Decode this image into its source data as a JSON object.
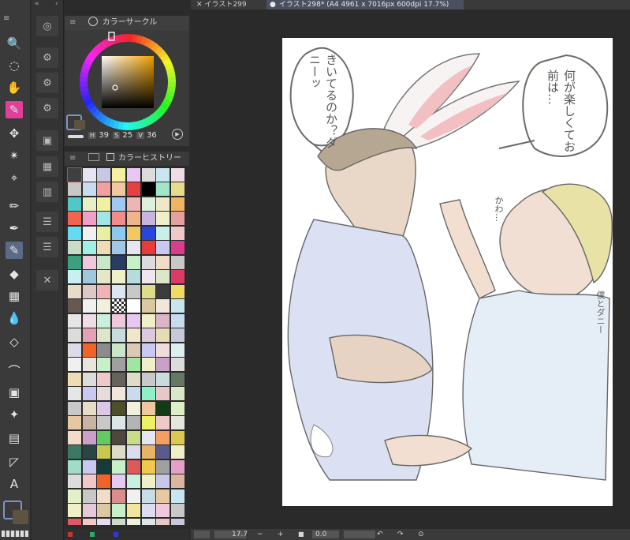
{
  "tabs": [
    {
      "label": "イラスト299",
      "active": false
    },
    {
      "label": "イラスト298* (A4 4961 x 7016px 600dpi 17.7%)",
      "active": true
    }
  ],
  "tools": [
    {
      "name": "zoom-icon",
      "glyph": "🔍"
    },
    {
      "name": "lasso-icon",
      "glyph": "◌"
    },
    {
      "name": "hand-icon",
      "glyph": "✋"
    },
    {
      "name": "pen-select-icon",
      "glyph": "✎"
    },
    {
      "name": "move-icon",
      "glyph": "✥"
    },
    {
      "name": "magic-wand-icon",
      "glyph": "✴"
    },
    {
      "name": "eyedropper-icon",
      "glyph": "⌖"
    },
    {
      "name": "pencil-icon",
      "glyph": "✏"
    },
    {
      "name": "ink-pen-icon",
      "glyph": "✒"
    },
    {
      "name": "brush-icon",
      "glyph": "✎"
    },
    {
      "name": "fill-icon",
      "glyph": "◆"
    },
    {
      "name": "airbrush-icon",
      "glyph": "▦"
    },
    {
      "name": "blend-icon",
      "glyph": "💧"
    },
    {
      "name": "eraser-icon",
      "glyph": "◇"
    },
    {
      "name": "vector-icon",
      "glyph": "⌒"
    },
    {
      "name": "gradient-icon",
      "glyph": "▣"
    },
    {
      "name": "sparkle-icon",
      "glyph": "✦"
    },
    {
      "name": "frame-icon",
      "glyph": "▤"
    },
    {
      "name": "ruler-icon",
      "glyph": "◸"
    },
    {
      "name": "text-icon",
      "glyph": "A"
    }
  ],
  "color_panel": {
    "title": "カラーサークル",
    "h_label": "H",
    "h_value": "39",
    "s_label": "S",
    "s_value": "25",
    "v_label": "V",
    "v_value": "36"
  },
  "history_panel": {
    "title": "カラーヒストリー"
  },
  "bottom_bar": {
    "zoom_value": "17.7",
    "rotate_value": "0.0"
  },
  "artwork": {
    "bubble_left_text": "きいてるのか？ダニーッ",
    "bubble_right_text": "何が楽しくてお前は…",
    "small_text": "かわ…",
    "signature": "僕とダニー"
  },
  "colors": {
    "accent_pink": "#e0409a",
    "panel_bg": "#3a3a3a",
    "canvas_bg": "#2a2a2a",
    "paper": "#ffffff"
  },
  "swatches": [
    "#404040",
    "#e6e6f0",
    "#c8c8e6",
    "#f5f0a0",
    "#e6c8f0",
    "#dcdcdc",
    "#c8e6f0",
    "#f0dce6",
    "#c8c8c8",
    "#c8dcf0",
    "#f0a0a0",
    "#f0c8a0",
    "#e64040",
    "#000000",
    "#a0e6c8",
    "#e6dc8c",
    "#50c8c8",
    "#e6f0c8",
    "#f0f0a0",
    "#a0c8f0",
    "#f0b4b4",
    "#dcf0dc",
    "#f0e6c8",
    "#f0b464",
    "#f06450",
    "#f0a0c8",
    "#a0e6e6",
    "#f08c8c",
    "#f0b48c",
    "#c8b4dc",
    "#f0f0c8",
    "#e6a0a0",
    "#64dcf0",
    "#f0f0f0",
    "#e6f0a0",
    "#8cc8f0",
    "#f0c864",
    "#2846dc",
    "#c8f0e6",
    "#f0c8c8",
    "#c8dcc8",
    "#a0f0e6",
    "#f0dcb4",
    "#a0c8e6",
    "#e6e6f0",
    "#e63c3c",
    "#c8c8f0",
    "#dc3c8c",
    "#3ca080",
    "#f0c8dc",
    "#c8e6c8",
    "#283c64",
    "#c8f0c8",
    "#dcdcdc",
    "#f0dcc8",
    "#c8c8c8",
    "#c8f0f0",
    "#a0c8dc",
    "#e6e6c8",
    "#f0f0c8",
    "#b4dcdc",
    "#f0e6f0",
    "#dce6c8",
    "#dc3c64",
    "#e6dcc8",
    "#dcc8c8",
    "#f0b4b4",
    "#dce6f0",
    "#c8c8c8",
    "#dcdc8c",
    "#3c3c3c",
    "#f0dc64",
    "#645a50",
    "#f0f0f0",
    "#f0f0dc",
    "#b4b4b4",
    "#ffffff",
    "#dcc8a0",
    "#f0e6dc",
    "#c8e6f0",
    "#e6e6e6",
    "#f0dce6",
    "#c8f0dc",
    "#f0c8dc",
    "#e6c8f0",
    "#f0f0c8",
    "#dcb4c8",
    "#c8dcf0",
    "#dcdcdc",
    "#e6a0b4",
    "#dce6c8",
    "#c8dcdc",
    "#f0e6c8",
    "#dcc8dc",
    "#e6dcb4",
    "#c8c8dc",
    "#dcdce6",
    "#f06428",
    "#8c8c8c",
    "#c8e6c8",
    "#dcc8b4",
    "#c8c8f0",
    "#f0dcdc",
    "#dcf0f0",
    "#f0f0f0",
    "#e6e6dc",
    "#c8f0c8",
    "#a0a0a0",
    "#a0e6a0",
    "#f0f0c8",
    "#c8a0c8",
    "#dcdcdc",
    "#f0dcb4",
    "#dcdcdc",
    "#f0c8c8",
    "#64645a",
    "#dcdcc8",
    "#c8c8c8",
    "#c8dcdc",
    "#647864",
    "#e6e6e6",
    "#c8c8f0",
    "#e6dcdc",
    "#f0e6dc",
    "#c8dcf0",
    "#8cf0c8",
    "#e6c8c8",
    "#dce6c8",
    "#c8c8c8",
    "#e6dcc8",
    "#dcc8e6",
    "#505028",
    "#f0f0dc",
    "#f0c8a0",
    "#143c14",
    "#dcf0c8",
    "#e6c8a0",
    "#c8b4a0",
    "#c8c8c8",
    "#dce6e6",
    "#b4b4b4",
    "#f0f064",
    "#f0c8c8",
    "#e6e6dc",
    "#f0dcc8",
    "#c8a0c8",
    "#64c864",
    "#504640",
    "#c8dc8c",
    "#e6e6f0",
    "#f0a064",
    "#dcc850",
    "#3c7864",
    "#284646",
    "#c8c850",
    "#dcdcc8",
    "#dcdcf0",
    "#e6b464",
    "#5a5a8c",
    "#f0f0c8",
    "#a0dcc8",
    "#c8c8f0",
    "#143c3c",
    "#c8f0c8",
    "#dc5a5a",
    "#f0c850",
    "#a0a0a0",
    "#e6a0c8",
    "#dcdcdc",
    "#f0c8c8",
    "#f06428",
    "#e6c8f0",
    "#c8f0dc",
    "#f0f0c8",
    "#c8c8e6",
    "#dcb4a0",
    "#e6f0c8",
    "#c8c8c8",
    "#f0dcc8",
    "#dc8c8c",
    "#f0f0f0",
    "#c8dce6",
    "#e6c8a0",
    "#c8e6f0",
    "#f0f0c8",
    "#e6c8dc",
    "#dcc8a0",
    "#c8f0c8",
    "#f0e6a0",
    "#dcdcf0",
    "#f0c8dc",
    "#c8c8c8",
    "#dc5a64",
    "#f0c8c8",
    "#e6dcf0",
    "#c8dcc8",
    "#f0f0dc",
    "#dce6e6",
    "#e6c8c8",
    "#c8c8dc"
  ]
}
